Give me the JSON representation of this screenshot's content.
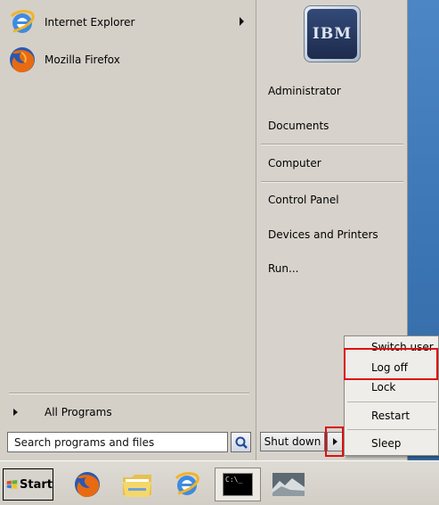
{
  "start_menu": {
    "pinned_programs": [
      {
        "label": "Internet Explorer",
        "icon": "ie-icon",
        "has_submenu": true
      },
      {
        "label": "Mozilla Firefox",
        "icon": "firefox-icon",
        "has_submenu": false
      }
    ],
    "all_programs_label": "All Programs",
    "search_placeholder": "Search programs and files",
    "user_picture_text": "IBM",
    "right_items": {
      "administrator": "Administrator",
      "documents": "Documents",
      "computer": "Computer",
      "control_panel": "Control Panel",
      "devices_printers": "Devices and Printers",
      "run": "Run..."
    },
    "shutdown_label": "Shut down"
  },
  "shutdown_submenu": {
    "items": [
      "Switch user",
      "Log off",
      "Lock",
      "Restart",
      "Sleep"
    ]
  },
  "taskbar": {
    "start_label": "Start",
    "icons": [
      "firefox-icon",
      "folder-icon",
      "ie-icon",
      "cmd-icon",
      "image-icon"
    ],
    "cmd_text": "C:\\_"
  },
  "colors": {
    "highlight_red": "#dd1111",
    "menu_bg": "#d4d0c8",
    "desktop_blue": "#3a73b2"
  }
}
